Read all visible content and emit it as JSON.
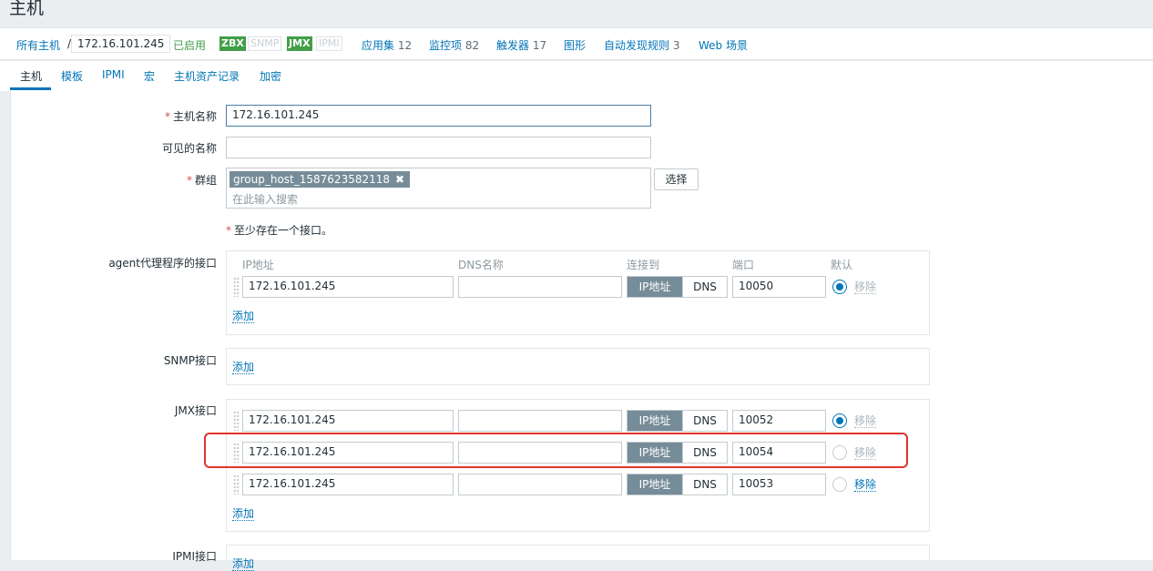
{
  "page": {
    "title": "主机"
  },
  "breadcrumb": {
    "all_hosts": "所有主机",
    "separator": "/",
    "current": "172.16.101.245",
    "status": "已启用"
  },
  "availability": {
    "zbx": "ZBX",
    "snmp": "SNMP",
    "jmx": "JMX",
    "ipmi": "IPMI"
  },
  "host_nav": [
    {
      "label": "应用集",
      "count": "12"
    },
    {
      "label": "监控项",
      "count": "82"
    },
    {
      "label": "触发器",
      "count": "17"
    },
    {
      "label": "图形",
      "count": ""
    },
    {
      "label": "自动发现规则",
      "count": "3"
    },
    {
      "label": "Web 场景",
      "count": ""
    }
  ],
  "tabs": [
    "主机",
    "模板",
    "IPMI",
    "宏",
    "主机资产记录",
    "加密"
  ],
  "form": {
    "host_name_label": "主机名称",
    "host_name_value": "172.16.101.245",
    "visible_name_label": "可见的名称",
    "visible_name_value": "",
    "groups_label": "群组",
    "group_chip": "group_host_1587623582118",
    "group_placeholder": "在此输入搜索",
    "select_button": "选择",
    "interface_note": "至少存在一个接口。",
    "required_mark": "*",
    "remove_icon": "✖"
  },
  "interfaces": {
    "headers": {
      "ip": "IP地址",
      "dns": "DNS名称",
      "connect_to": "连接到",
      "port": "端口",
      "default": "默认"
    },
    "toggle_ip": "IP地址",
    "toggle_dns": "DNS",
    "remove_label": "移除",
    "add_label": "添加",
    "agent": {
      "label": "agent代理程序的接口",
      "rows": [
        {
          "ip": "172.16.101.245",
          "dns": "",
          "port": "10050",
          "default": true
        }
      ]
    },
    "snmp": {
      "label": "SNMP接口"
    },
    "jmx": {
      "label": "JMX接口",
      "rows": [
        {
          "ip": "172.16.101.245",
          "dns": "",
          "port": "10052",
          "default": true
        },
        {
          "ip": "172.16.101.245",
          "dns": "",
          "port": "10054",
          "default": false
        },
        {
          "ip": "172.16.101.245",
          "dns": "",
          "port": "10053",
          "default": false
        }
      ]
    },
    "ipmi": {
      "label": "IPMI接口"
    }
  },
  "colors": {
    "link": "#0275b8",
    "enabled_green": "#429e47",
    "highlight_red": "#e0342b"
  }
}
